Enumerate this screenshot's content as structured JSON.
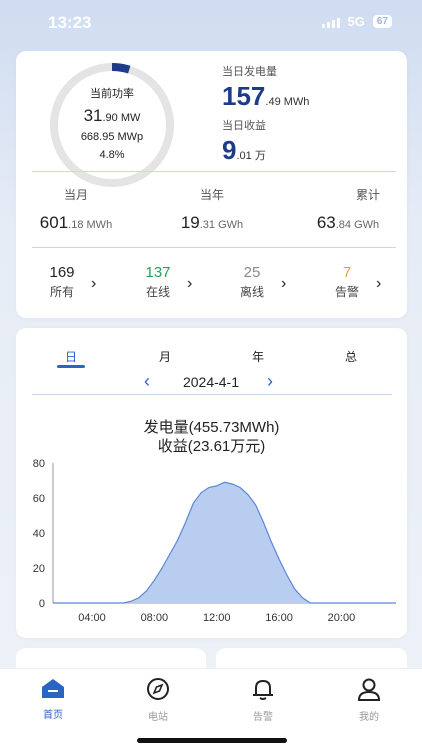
{
  "status": {
    "time": "13:23",
    "network": "5G",
    "battery": "67"
  },
  "gauge": {
    "label": "当前功率",
    "power_main": "31",
    "power_dec": ".90 MW",
    "capacity": "668.95 MWp",
    "percent": "4.8%",
    "fraction": 0.048,
    "accent": "#1e3b8a"
  },
  "today": {
    "gen_label": "当日发电量",
    "gen_main": "157",
    "gen_dec": ".49 MWh",
    "income_label": "当日收益",
    "income_main": "9",
    "income_dec": ".01 万"
  },
  "totals": [
    {
      "label": "当月",
      "main": "601",
      "dec": ".18 MWh"
    },
    {
      "label": "当年",
      "main": "19",
      "dec": ".31 GWh"
    },
    {
      "label": "累计",
      "main": "63",
      "dec": ".84 GWh"
    }
  ],
  "counts": [
    {
      "num": "169",
      "label": "所有",
      "color": "#222222"
    },
    {
      "num": "137",
      "label": "在线",
      "color": "#2e9a5c"
    },
    {
      "num": "25",
      "label": "离线",
      "color": "#8a8a8a"
    },
    {
      "num": "7",
      "label": "告警",
      "color": "#e6a23c"
    }
  ],
  "arrow_glyph": "›",
  "period_tabs": [
    "日",
    "月",
    "年",
    "总"
  ],
  "active_tab": 0,
  "date": {
    "value": "2024-4-1",
    "prev": "‹",
    "next": "›"
  },
  "chart_title": {
    "line1": "发电量(455.73MWh)",
    "line2": "收益(23.61万元)"
  },
  "chart_data": {
    "type": "area",
    "title": "发电量(455.73MWh) 收益(23.61万元)",
    "xlabel": "",
    "ylabel": "",
    "xlim": [
      1.5,
      23.5
    ],
    "ylim": [
      0,
      80
    ],
    "yticks": [
      0,
      20,
      40,
      60,
      80
    ],
    "xticks": [
      "04:00",
      "08:00",
      "12:00",
      "16:00",
      "20:00"
    ],
    "xtick_hours": [
      4,
      8,
      12,
      16,
      20
    ],
    "grid": false,
    "color": "#5b86d6",
    "fill": "#b8cdf0",
    "x": [
      1.5,
      6.0,
      6.5,
      7.0,
      7.5,
      8.0,
      8.5,
      9.0,
      9.5,
      10.0,
      10.5,
      11.0,
      11.5,
      12.0,
      12.5,
      13.0,
      13.5,
      14.0,
      14.5,
      15.0,
      15.5,
      16.0,
      16.5,
      17.0,
      17.5,
      18.0,
      23.5
    ],
    "y": [
      0,
      0,
      1,
      3,
      7,
      13,
      20,
      28,
      36,
      46,
      57,
      63,
      66,
      67,
      69,
      68,
      66,
      62,
      56,
      46,
      35,
      25,
      16,
      8,
      3,
      0,
      0
    ]
  },
  "nav": [
    {
      "label": "首页",
      "icon": "home-icon",
      "active": true
    },
    {
      "label": "电站",
      "icon": "compass-icon",
      "active": false
    },
    {
      "label": "告警",
      "icon": "bell-icon",
      "active": false
    },
    {
      "label": "我的",
      "icon": "user-icon",
      "active": false
    }
  ],
  "colors": {
    "primary": "#2a64c5",
    "dark_blue": "#1e3b8a"
  }
}
